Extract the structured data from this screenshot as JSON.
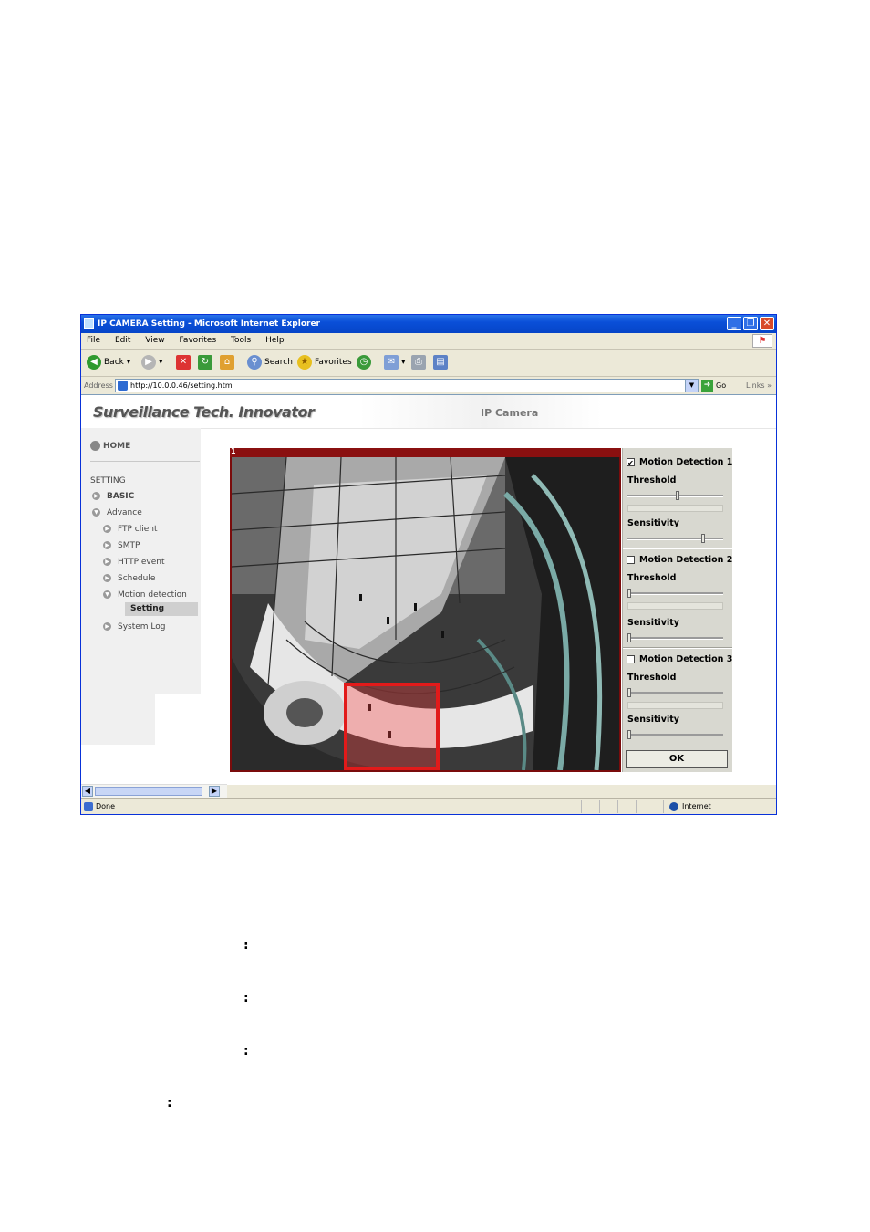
{
  "window": {
    "title": "IP CAMERA Setting - Microsoft Internet Explorer",
    "minimize": "_",
    "maximize": "❐",
    "close": "✕"
  },
  "menu": [
    "File",
    "Edit",
    "View",
    "Favorites",
    "Tools",
    "Help"
  ],
  "toolbar": {
    "back": "Back",
    "search": "Search",
    "favorites": "Favorites"
  },
  "address": {
    "label": "Address",
    "url": "http://10.0.0.46/setting.htm",
    "go": "Go",
    "links": "Links"
  },
  "page": {
    "brand": "Surveillance Tech. Innovator",
    "product": "IP Camera"
  },
  "sidebar": {
    "home": "HOME",
    "section": "SETTING",
    "items": [
      "BASIC",
      "Advance",
      "FTP client",
      "SMTP",
      "HTTP event",
      "Schedule",
      "Motion detection",
      "Setting",
      "System Log"
    ]
  },
  "camera": {
    "label": "1"
  },
  "motion": {
    "sections": [
      {
        "title": "Motion Detection 1",
        "checked": true,
        "threshold_label": "Threshold",
        "sensitivity_label": "Sensitivity",
        "threshold": 0.52,
        "sensitivity": 0.8
      },
      {
        "title": "Motion Detection 2",
        "checked": false,
        "threshold_label": "Threshold",
        "sensitivity_label": "Sensitivity",
        "threshold": 0.0,
        "sensitivity": 0.0
      },
      {
        "title": "Motion Detection 3",
        "checked": false,
        "threshold_label": "Threshold",
        "sensitivity_label": "Sensitivity",
        "threshold": 0.0,
        "sensitivity": 0.0
      }
    ],
    "ok": "OK"
  },
  "status": {
    "text": "Done",
    "zone": "Internet"
  },
  "doc": {
    "colon": ":"
  }
}
